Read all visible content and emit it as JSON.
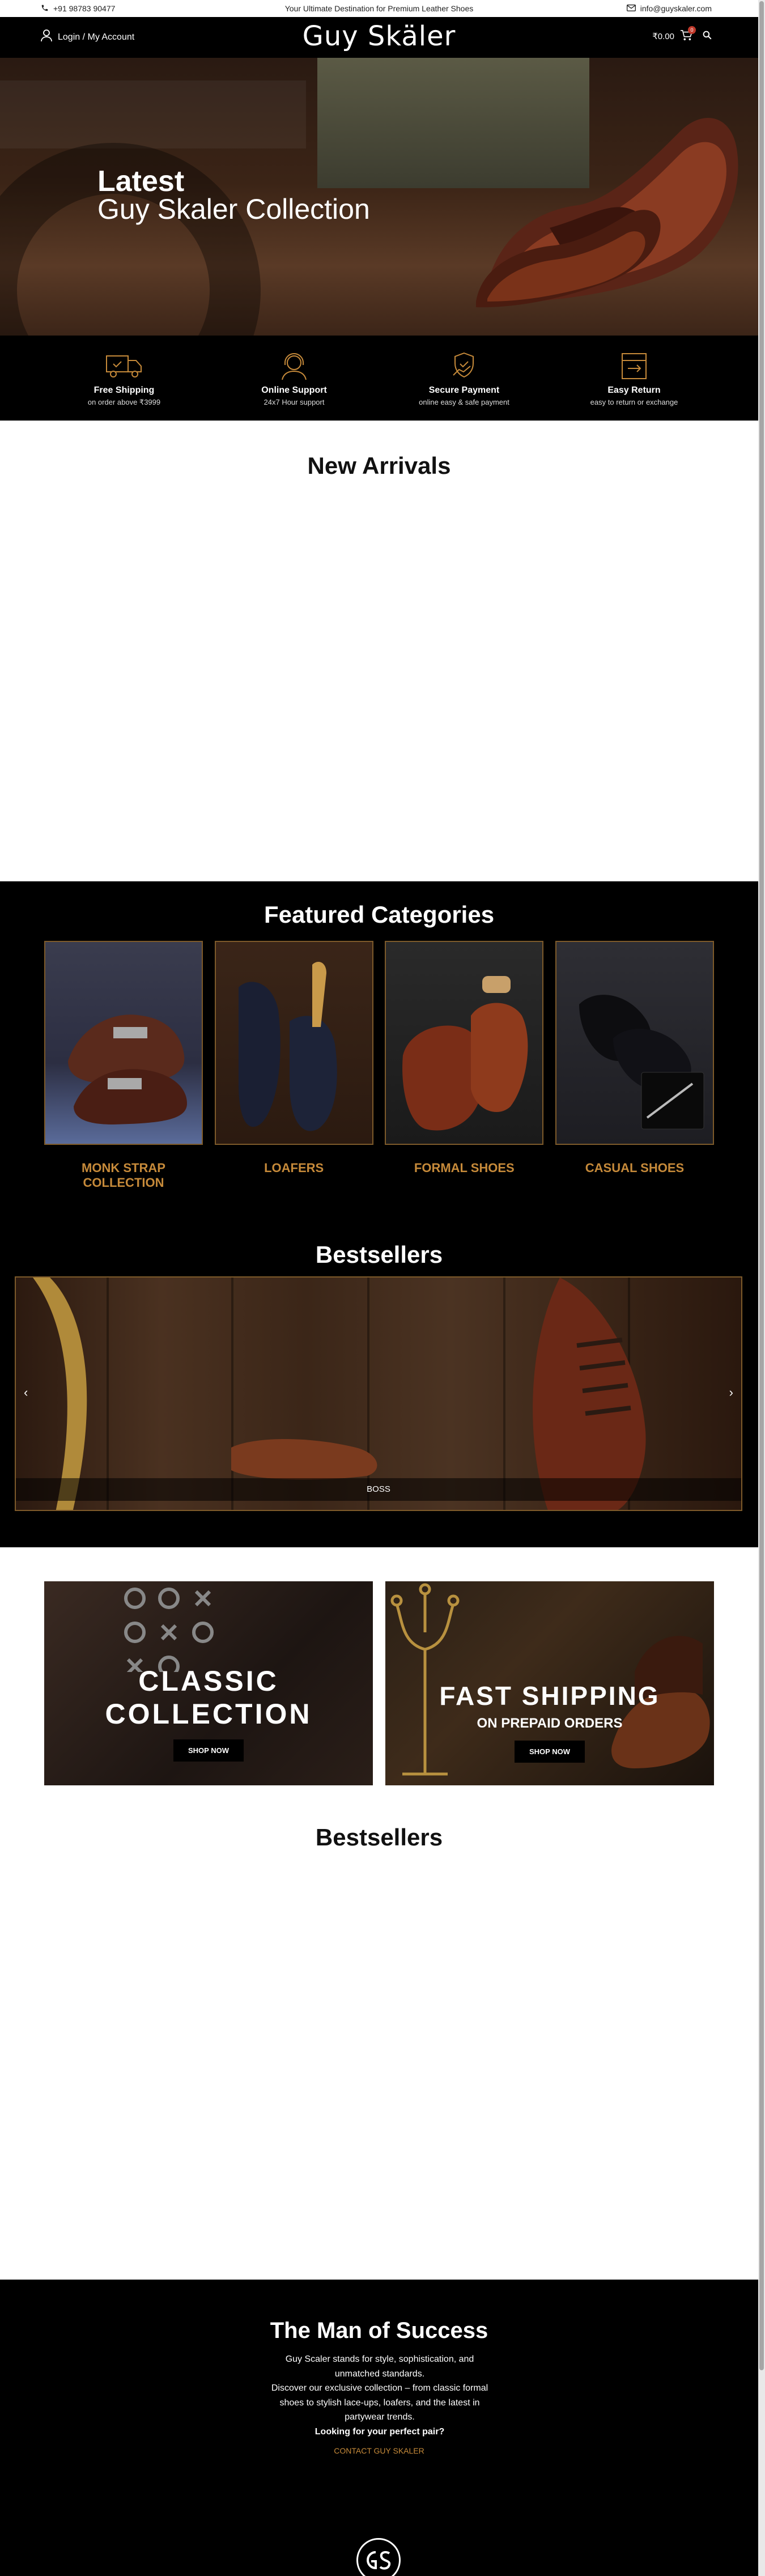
{
  "topbar": {
    "phone": "+91 98783 90477",
    "tagline": "Your Ultimate Destination for Premium Leather Shoes",
    "email": "info@guyskaler.com"
  },
  "header": {
    "account_label": "Login / My Account",
    "logo_text": "Guy Skäler",
    "cart_total": "₹0.00",
    "cart_count": "0"
  },
  "hero": {
    "title_line1": "Latest",
    "title_line2": "Guy Skaler Collection"
  },
  "features": [
    {
      "title": "Free Shipping",
      "subtitle": "on order above ₹3999",
      "icon": "truck-icon"
    },
    {
      "title": "Online Support",
      "subtitle": "24x7 Hour support",
      "icon": "headset-icon"
    },
    {
      "title": "Secure Payment",
      "subtitle": "online easy & safe payment",
      "icon": "secure-payment-icon"
    },
    {
      "title": "Easy Return",
      "subtitle": "easy to return or exchange",
      "icon": "return-box-icon"
    }
  ],
  "new_arrivals": {
    "title": "New Arrivals"
  },
  "featured_categories": {
    "title": "Featured Categories",
    "items": [
      {
        "label": "MONK STRAP COLLECTION"
      },
      {
        "label": "LOAFERS"
      },
      {
        "label": "FORMAL SHOES"
      },
      {
        "label": "CASUAL SHOES"
      }
    ]
  },
  "bestsellers_carousel": {
    "title": "Bestsellers",
    "caption": "BOSS"
  },
  "promos": {
    "classic": {
      "title_line1": "CLASSIC",
      "title_line2": "COLLECTION",
      "button": "SHOP NOW"
    },
    "shipping": {
      "title": "FAST SHIPPING",
      "subtitle": "ON PREPAID ORDERS",
      "button": "SHOP NOW"
    }
  },
  "bestsellers2": {
    "title": "Bestsellers"
  },
  "footer": {
    "title": "The Man of Success",
    "body_line1": "Guy Scaler stands for style, sophistication, and unmatched standards.",
    "body_line2": "Discover our exclusive collection – from classic formal shoes to stylish lace-ups, loafers, and the latest in partywear trends.",
    "question": "Looking for your perfect pair?",
    "contact_link": "CONTACT GUY SKALER"
  }
}
